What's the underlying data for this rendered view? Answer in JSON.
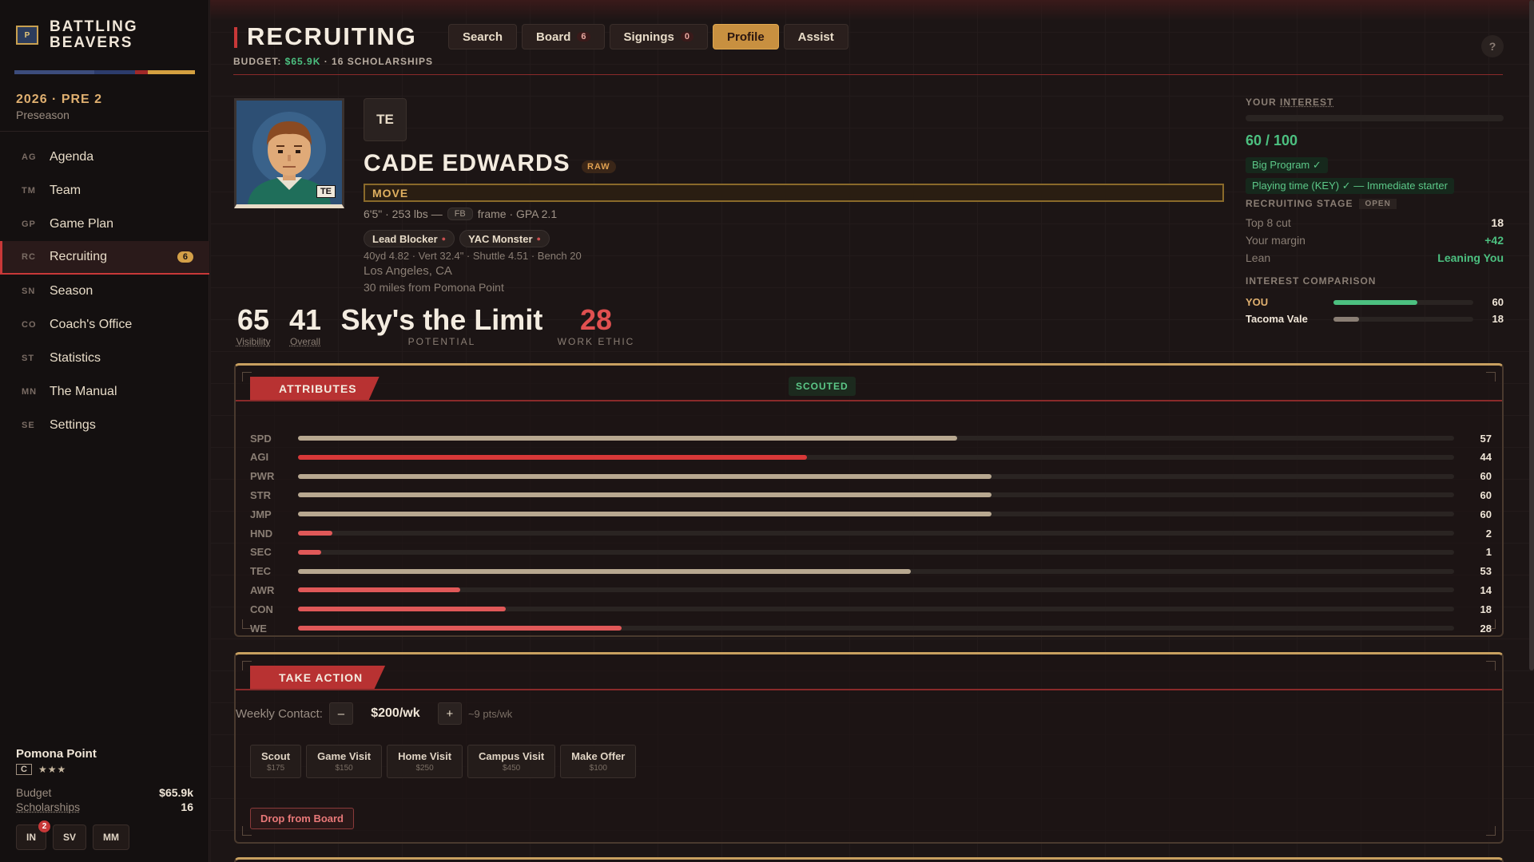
{
  "app": {
    "brand_line1": "BATTLING",
    "brand_line2": "BEAVERS",
    "brand_logo": "P",
    "season_title": "2026 · PRE 2",
    "season_sub": "Preseason",
    "stripe_colors": [
      "#3c4c7c",
      "#2c3c6c",
      "#a02828",
      "#d4a040"
    ]
  },
  "nav": [
    {
      "abbr": "AG",
      "label": "Agenda"
    },
    {
      "abbr": "TM",
      "label": "Team"
    },
    {
      "abbr": "GP",
      "label": "Game Plan"
    },
    {
      "abbr": "RC",
      "label": "Recruiting",
      "badge": "6",
      "active": true
    },
    {
      "abbr": "SN",
      "label": "Season"
    },
    {
      "abbr": "CO",
      "label": "Coach's Office"
    },
    {
      "abbr": "ST",
      "label": "Statistics"
    },
    {
      "abbr": "MN",
      "label": "The Manual"
    },
    {
      "abbr": "SE",
      "label": "Settings"
    }
  ],
  "footer": {
    "team": "Pomona Point",
    "grade": "C",
    "stars": "★★★",
    "budget_label": "Budget",
    "budget_value": "$65.9k",
    "scholarships_label": "Scholarships",
    "scholarships_value": "16",
    "btn_in": "IN",
    "btn_in_count": "2",
    "btn_sv": "SV",
    "btn_mm": "MM"
  },
  "header": {
    "title": "RECRUITING",
    "tabs": [
      {
        "label": "Search"
      },
      {
        "label": "Board",
        "count": "6"
      },
      {
        "label": "Signings",
        "count": "0"
      },
      {
        "label": "Profile",
        "active": true
      },
      {
        "label": "Assist"
      }
    ],
    "help": "?",
    "budget_prefix": "BUDGET: ",
    "budget_money": "$65.9K",
    "budget_suffix": " · 16 SCHOLARSHIPS"
  },
  "player": {
    "position": "TE",
    "portrait_tag": "TE",
    "name": "CADE EDWARDS",
    "raw": "RAW",
    "move": "MOVE",
    "phys_pre": "6'5\" · 253 lbs —",
    "frame_tag": "FB",
    "phys_post": "frame · GPA 2.1",
    "traits": [
      "Lead Blocker",
      "YAC Monster"
    ],
    "measurables": "40yd 4.82 · Vert 32.4\" · Shuttle 4.51 · Bench 20",
    "hometown": "Los Angeles, CA",
    "distance": "30 miles from Pomona Point",
    "visibility": "65",
    "visibility_label": "Visibility",
    "overall": "41",
    "overall_label": "Overall",
    "potential": "Sky's the Limit",
    "potential_label": "POTENTIAL",
    "work_ethic": "28",
    "work_ethic_label": "WORK ETHIC"
  },
  "interest": {
    "label_pre": "YOUR ",
    "label_link": "INTEREST",
    "value_text": "60 / 100",
    "value": 60,
    "max": 100,
    "chip1": "Big Program ✓",
    "chip2": "Playing time (KEY) ✓ — Immediate starter",
    "stage_label": "RECRUITING STAGE",
    "stage_value": "OPEN",
    "top8_label": "Top 8 cut",
    "top8_value": "18",
    "margin_label": "Your margin",
    "margin_value": "+42",
    "lean_label": "Lean",
    "lean_value": "Leaning You",
    "comparison_label": "INTEREST COMPARISON",
    "comparison": [
      {
        "who": "YOU",
        "value": 60,
        "display": "60",
        "color": "#4cc080"
      },
      {
        "who": "Tacoma Vale",
        "value": 18,
        "display": "18",
        "color": "#8a7e74"
      }
    ]
  },
  "attributes": {
    "title": "ATTRIBUTES",
    "scouted": "SCOUTED",
    "max": 100,
    "rows": [
      {
        "name": "SPD",
        "value": 57,
        "color": "#b8a890"
      },
      {
        "name": "AGI",
        "value": 44,
        "color": "#d83838"
      },
      {
        "name": "PWR",
        "value": 60,
        "color": "#b8a890"
      },
      {
        "name": "STR",
        "value": 60,
        "color": "#b8a890"
      },
      {
        "name": "JMP",
        "value": 60,
        "color": "#b8a890"
      },
      {
        "name": "HND",
        "value": 2,
        "color": "#e05858"
      },
      {
        "name": "SEC",
        "value": 1,
        "color": "#e05858"
      },
      {
        "name": "TEC",
        "value": 53,
        "color": "#b8a890"
      },
      {
        "name": "AWR",
        "value": 14,
        "color": "#e05858"
      },
      {
        "name": "CON",
        "value": 18,
        "color": "#e05858"
      },
      {
        "name": "WE",
        "value": 28,
        "color": "#e05858"
      }
    ]
  },
  "actions": {
    "title": "TAKE ACTION",
    "weekly_label": "Weekly Contact:",
    "minus": "–",
    "plus": "+",
    "weekly_value": "$200/wk",
    "weekly_pts": "~9 pts/wk",
    "buttons": [
      {
        "label": "Scout",
        "cost": "$175"
      },
      {
        "label": "Game Visit",
        "cost": "$150"
      },
      {
        "label": "Home Visit",
        "cost": "$250"
      },
      {
        "label": "Campus Visit",
        "cost": "$450"
      },
      {
        "label": "Make Offer",
        "cost": "$100"
      }
    ],
    "drop": "Drop from Board"
  }
}
